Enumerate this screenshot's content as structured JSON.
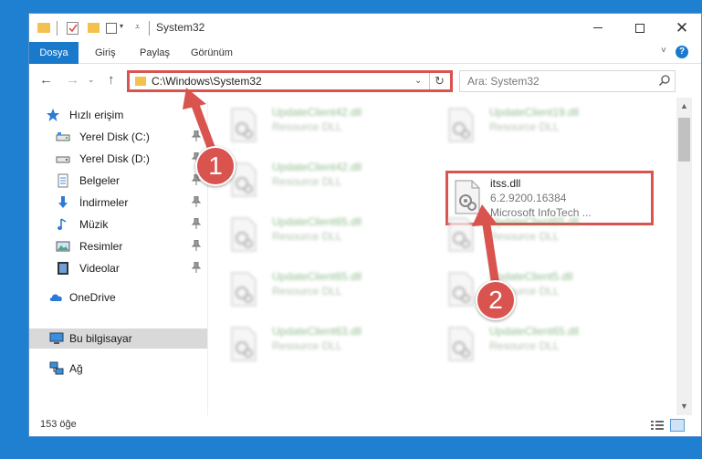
{
  "window": {
    "title": "System32"
  },
  "ribbon": {
    "tabs": [
      {
        "label": "Dosya"
      },
      {
        "label": "Giriş"
      },
      {
        "label": "Paylaş"
      },
      {
        "label": "Görünüm"
      }
    ]
  },
  "address": {
    "path": "C:\\Windows\\System32"
  },
  "search": {
    "placeholder": "Ara: System32"
  },
  "sidebar": {
    "items": [
      {
        "label": "Hızlı erişim",
        "icon": "star-icon",
        "pinned": false
      },
      {
        "label": "Yerel Disk (C:)",
        "icon": "drive-icon",
        "pinned": true
      },
      {
        "label": "Yerel Disk (D:)",
        "icon": "drive-icon",
        "pinned": true
      },
      {
        "label": "Belgeler",
        "icon": "documents-icon",
        "pinned": true
      },
      {
        "label": "İndirmeler",
        "icon": "download-icon",
        "pinned": true
      },
      {
        "label": "Müzik",
        "icon": "music-icon",
        "pinned": true
      },
      {
        "label": "Resimler",
        "icon": "pictures-icon",
        "pinned": true
      },
      {
        "label": "Videolar",
        "icon": "videos-icon",
        "pinned": true
      },
      {
        "label": "OneDrive",
        "icon": "cloud-icon",
        "pinned": false
      },
      {
        "label": "Bu bilgisayar",
        "icon": "computer-icon",
        "pinned": false,
        "selected": true
      },
      {
        "label": "Ağ",
        "icon": "network-icon",
        "pinned": false
      }
    ]
  },
  "files": [
    {
      "name": "UpdateClient42.dll",
      "desc": "Resource DLL",
      "blurred": true
    },
    {
      "name": "UpdateClient19.dll",
      "desc": "Resource DLL",
      "blurred": true
    },
    {
      "name": "UpdateClient42.dll",
      "desc": "Resource DLL",
      "blurred": true
    },
    {
      "name": "itss.dll",
      "desc": "6.2.9200.16384",
      "desc2": "Microsoft InfoTech ...",
      "blurred": false,
      "highlighted": true
    },
    {
      "name": "UpdateClient65.dll",
      "desc": "Resource DLL",
      "blurred": true
    },
    {
      "name": "UpdateClient65.dll",
      "desc": "Resource DLL",
      "blurred": true
    },
    {
      "name": "UpdateClient65.dll",
      "desc": "Resource DLL",
      "blurred": true
    },
    {
      "name": "UpdateClient5.dll",
      "desc": "Resource DLL",
      "blurred": true
    },
    {
      "name": "UpdateClient63.dll",
      "desc": "Resource DLL",
      "blurred": true
    },
    {
      "name": "UpdateClient65.dll",
      "desc": "Resource DLL",
      "blurred": true
    }
  ],
  "status": {
    "count": "153 öğe"
  },
  "annotations": {
    "badge1": "1",
    "badge2": "2",
    "color": "#d9534f"
  },
  "colors": {
    "accent": "#1979ca",
    "folder": "#f2c14e",
    "desktop": "#1f7fd0"
  }
}
